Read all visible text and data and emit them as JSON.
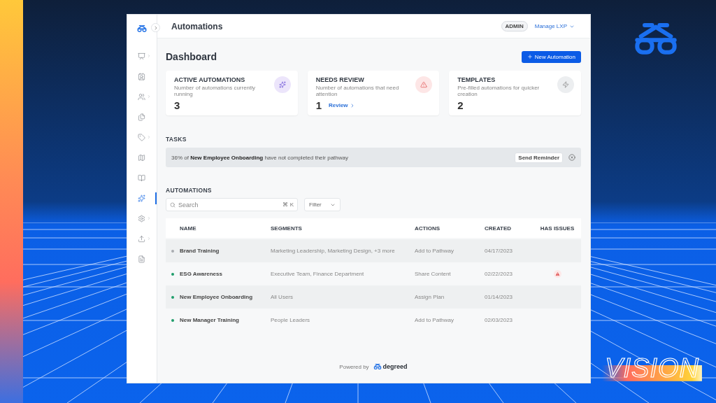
{
  "window": {
    "title": "Automations",
    "admin_badge": "ADMIN",
    "account_menu": "Manage LXP"
  },
  "sidebar": {
    "items": [
      {
        "has_submenu": true,
        "selected": false
      },
      {
        "has_submenu": false,
        "selected": false
      },
      {
        "has_submenu": true,
        "selected": false
      },
      {
        "has_submenu": false,
        "selected": false
      },
      {
        "has_submenu": true,
        "selected": false
      },
      {
        "has_submenu": false,
        "selected": false
      },
      {
        "has_submenu": false,
        "selected": false
      },
      {
        "has_submenu": false,
        "selected": true
      },
      {
        "has_submenu": true,
        "selected": false
      },
      {
        "has_submenu": true,
        "selected": false
      },
      {
        "has_submenu": false,
        "selected": false
      }
    ]
  },
  "dashboard": {
    "heading": "Dashboard",
    "new_button": "New Automation",
    "cards": [
      {
        "kind": "active",
        "title": "ACTIVE AUTOMATIONS",
        "subtitle": "Number of automations currently running",
        "value": "3"
      },
      {
        "kind": "review",
        "title": "NEEDS REVIEW",
        "subtitle": "Number of automations that need attention",
        "value": "1",
        "link": "Review"
      },
      {
        "kind": "templates",
        "title": "TEMPLATES",
        "subtitle": "Pre-filled automations for quicker creation",
        "value": "2"
      }
    ]
  },
  "tasks": {
    "heading": "TASKS",
    "banner": {
      "text": "36% of **New Employee Onboarding** have not completed their pathway",
      "button": "Send Reminder"
    }
  },
  "automations": {
    "heading": "AUTOMATIONS",
    "search": {
      "placeholder": "Search",
      "shortcut": "⌘ K"
    },
    "filter": "Filter",
    "columns": [
      "NAME",
      "SEGMENTS",
      "ACTIONS",
      "CREATED",
      "HAS ISSUES"
    ],
    "rows": [
      {
        "active": false,
        "name": "Brand Training",
        "segments": "Marketing Leadership, Marketing Design, +3 more",
        "actions": "Add to Pathway",
        "created": "04/17/2023",
        "has_issues": false
      },
      {
        "active": true,
        "name": "ESG Awareness",
        "segments": "Executive Team, Finance Department",
        "actions": "Share Content",
        "created": "02/22/2023",
        "has_issues": true
      },
      {
        "active": true,
        "name": "New Employee Onboarding",
        "segments": "All Users",
        "actions": "Assign Plan",
        "created": "01/14/2023",
        "has_issues": false
      },
      {
        "active": true,
        "name": "New Manager Training",
        "segments": "People Leaders",
        "actions": "Add to Pathway",
        "created": "02/03/2023",
        "has_issues": false
      }
    ]
  },
  "footer": {
    "powered_by": "Powered by",
    "brand": "degreed"
  },
  "slide": {
    "caption": "VISION"
  }
}
